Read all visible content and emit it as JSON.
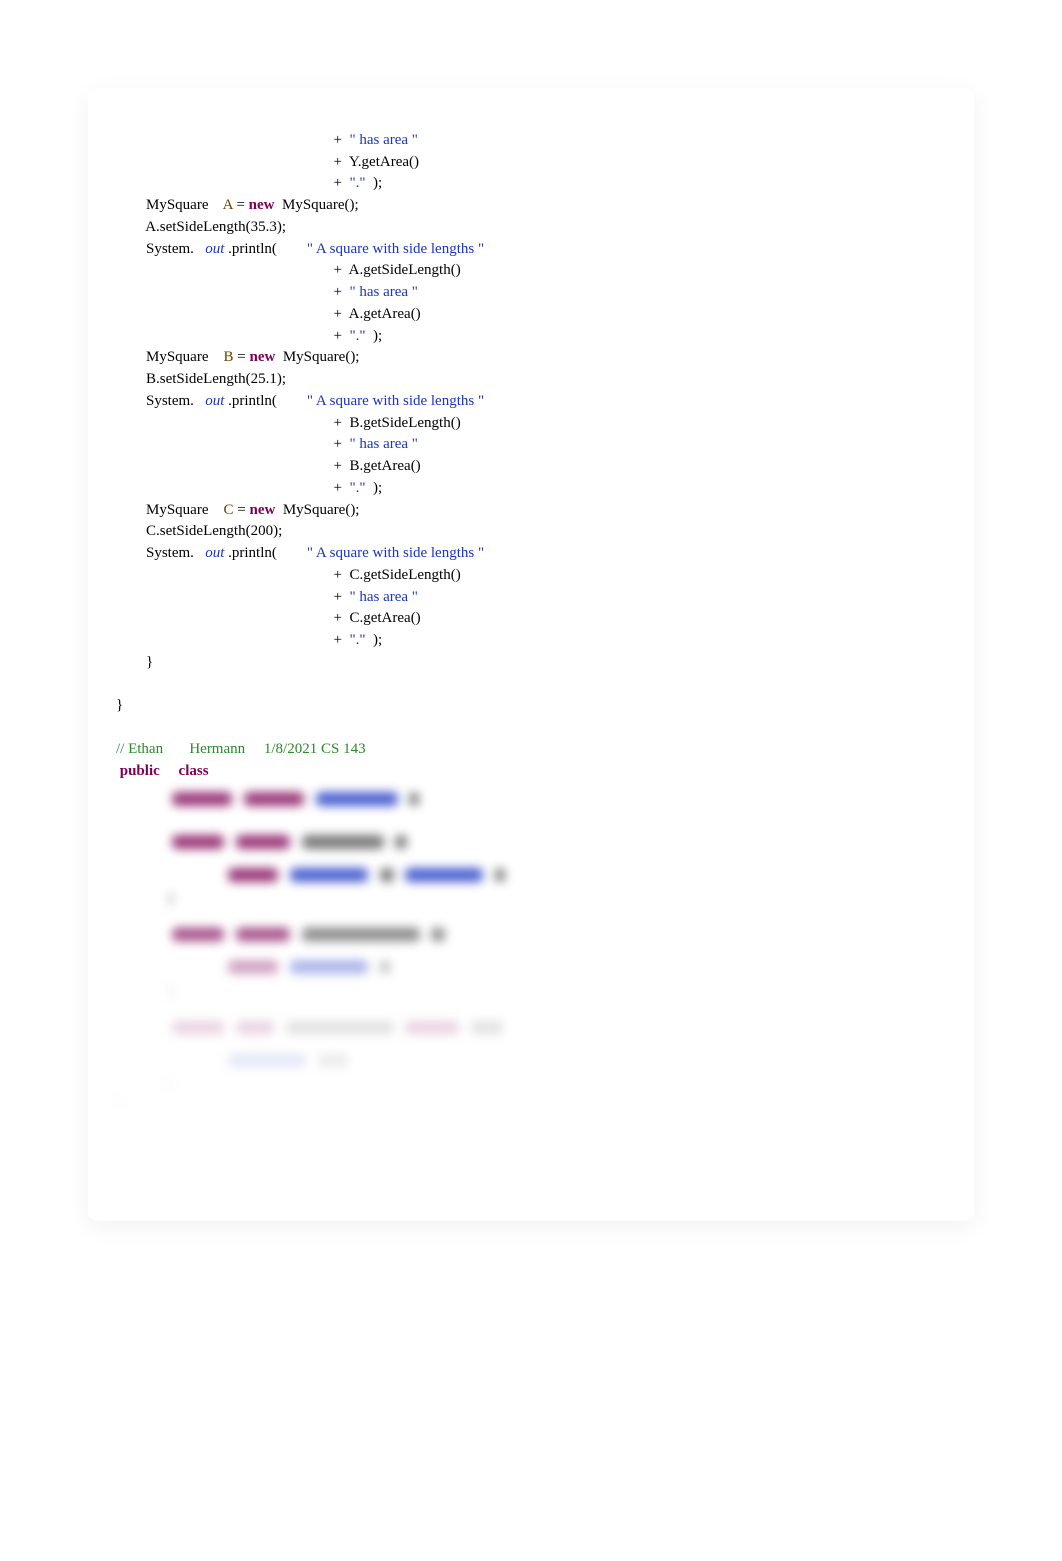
{
  "colors": {
    "keyword": "#7e0053",
    "string": "#1a34c4",
    "field": "#1a34c4",
    "variable": "#6a3e00",
    "comment": "#2a8a2a",
    "text": "#000000",
    "card_shadow": "rgba(0,0,0,0.06)"
  },
  "code": {
    "plus": "+  ",
    "str_has_area": "\" has area \"",
    "y_getArea": "Y.getArea()",
    "str_period": "\".\"",
    "paren_semi": "  );",
    "a_decl_p1": "MySquare    ",
    "a_decl_var": "A",
    "a_decl_p2": " = ",
    "kw_new": "new",
    "a_decl_p3": "  MySquare();",
    "a_setside": "A.setSideLength(35.3);",
    "sys_p1": "System.   ",
    "sys_out": "out",
    "sys_p2": " .println(        ",
    "str_square": "\" A square with side lengths \"",
    "a_getside": "A.getSideLength()",
    "a_getarea": "A.getArea()",
    "b_decl_var": "B",
    "b_setside": "B.setSideLength(25.1);",
    "b_getside": "B.getSideLength()",
    "b_getarea": "B.getArea()",
    "c_decl_var": "C",
    "c_setside": "C.setSideLength(200);",
    "c_getside": "C.getSideLength()",
    "c_getarea": "C.getArea()",
    "brace_close1": "}",
    "brace_close0": "}",
    "comment_line": "// Ethan       Hermann     1/8/2021 CS 143",
    "kw_public": " public",
    "kw_class": "class"
  }
}
